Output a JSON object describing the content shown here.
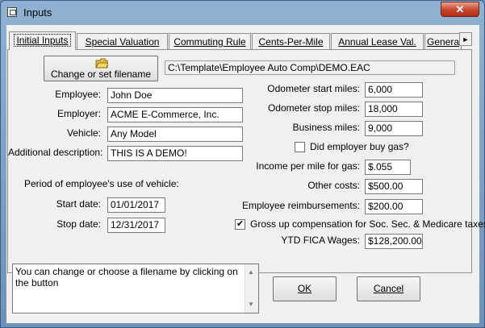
{
  "window": {
    "title": "Inputs",
    "close_glyph": "✕"
  },
  "tabs": [
    "Initial Inputs",
    "Special Valuation",
    "Commuting Rule",
    "Cents-Per-Mile",
    "Annual Lease Val.",
    "Genera"
  ],
  "tab_scroll_glyph": "►",
  "file": {
    "button_label": "Change or set filename",
    "path": "C:\\Template\\Employee Auto Comp\\DEMO.EAC"
  },
  "employee": {
    "employee_label": "Employee:",
    "employee_value": "John Doe",
    "employer_label": "Employer:",
    "employer_value": "ACME E-Commerce, Inc.",
    "vehicle_label": "Vehicle:",
    "vehicle_value": "Any Model",
    "desc_label": "Additional description:",
    "desc_value": "THIS IS A DEMO!"
  },
  "period": {
    "heading": "Period of employee's use of vehicle:",
    "start_label": "Start date:",
    "start_value": "01/01/2017",
    "stop_label": "Stop date:",
    "stop_value": "12/31/2017"
  },
  "odometer": {
    "start_label": "Odometer start miles:",
    "start_value": "6,000",
    "stop_label": "Odometer stop miles:",
    "stop_value": "18,000",
    "business_label": "Business miles:",
    "business_value": "9,000"
  },
  "gas": {
    "label": "Did employer buy gas?",
    "checked": false
  },
  "income": {
    "label": "Income per mile for gas:",
    "value": "$.055"
  },
  "other_costs": {
    "label": "Other costs:",
    "value": "$500.00"
  },
  "reimb": {
    "label": "Employee reimbursements:",
    "value": "$200.00"
  },
  "grossup": {
    "label": "Gross up compensation for Soc. Sec. & Medicare taxes?",
    "checked": true,
    "mark": "✔"
  },
  "ytd": {
    "label": "YTD FICA Wages:",
    "value": "$128,200.00"
  },
  "help_text": "You can change or choose a filename by clicking on the button",
  "buttons": {
    "ok": "OK",
    "cancel": "Cancel"
  }
}
